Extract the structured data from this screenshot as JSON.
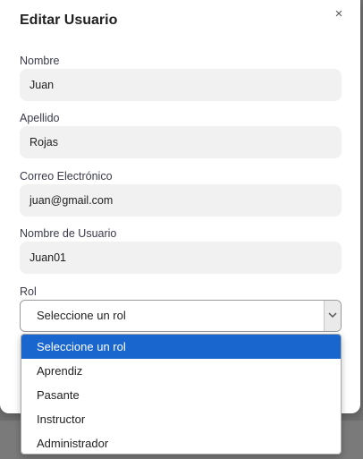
{
  "modal": {
    "title": "Editar Usuario",
    "close_glyph": "×"
  },
  "fields": {
    "nombre": {
      "label": "Nombre",
      "value": "Juan"
    },
    "apellido": {
      "label": "Apellido",
      "value": "Rojas"
    },
    "correo": {
      "label": "Correo Electrónico",
      "value": "juan@gmail.com"
    },
    "usuario": {
      "label": "Nombre de Usuario",
      "value": "Juan01"
    }
  },
  "rol": {
    "label": "Rol",
    "selected": "Seleccione un rol",
    "options": [
      "Seleccione un rol",
      "Aprendiz",
      "Pasante",
      "Instructor",
      "Administrador"
    ]
  },
  "colors": {
    "accent": "#1a66cf",
    "input_bg": "#f1f1f2"
  },
  "icons": {
    "close": "close-icon",
    "select_arrow": "chevron-down-icon"
  }
}
